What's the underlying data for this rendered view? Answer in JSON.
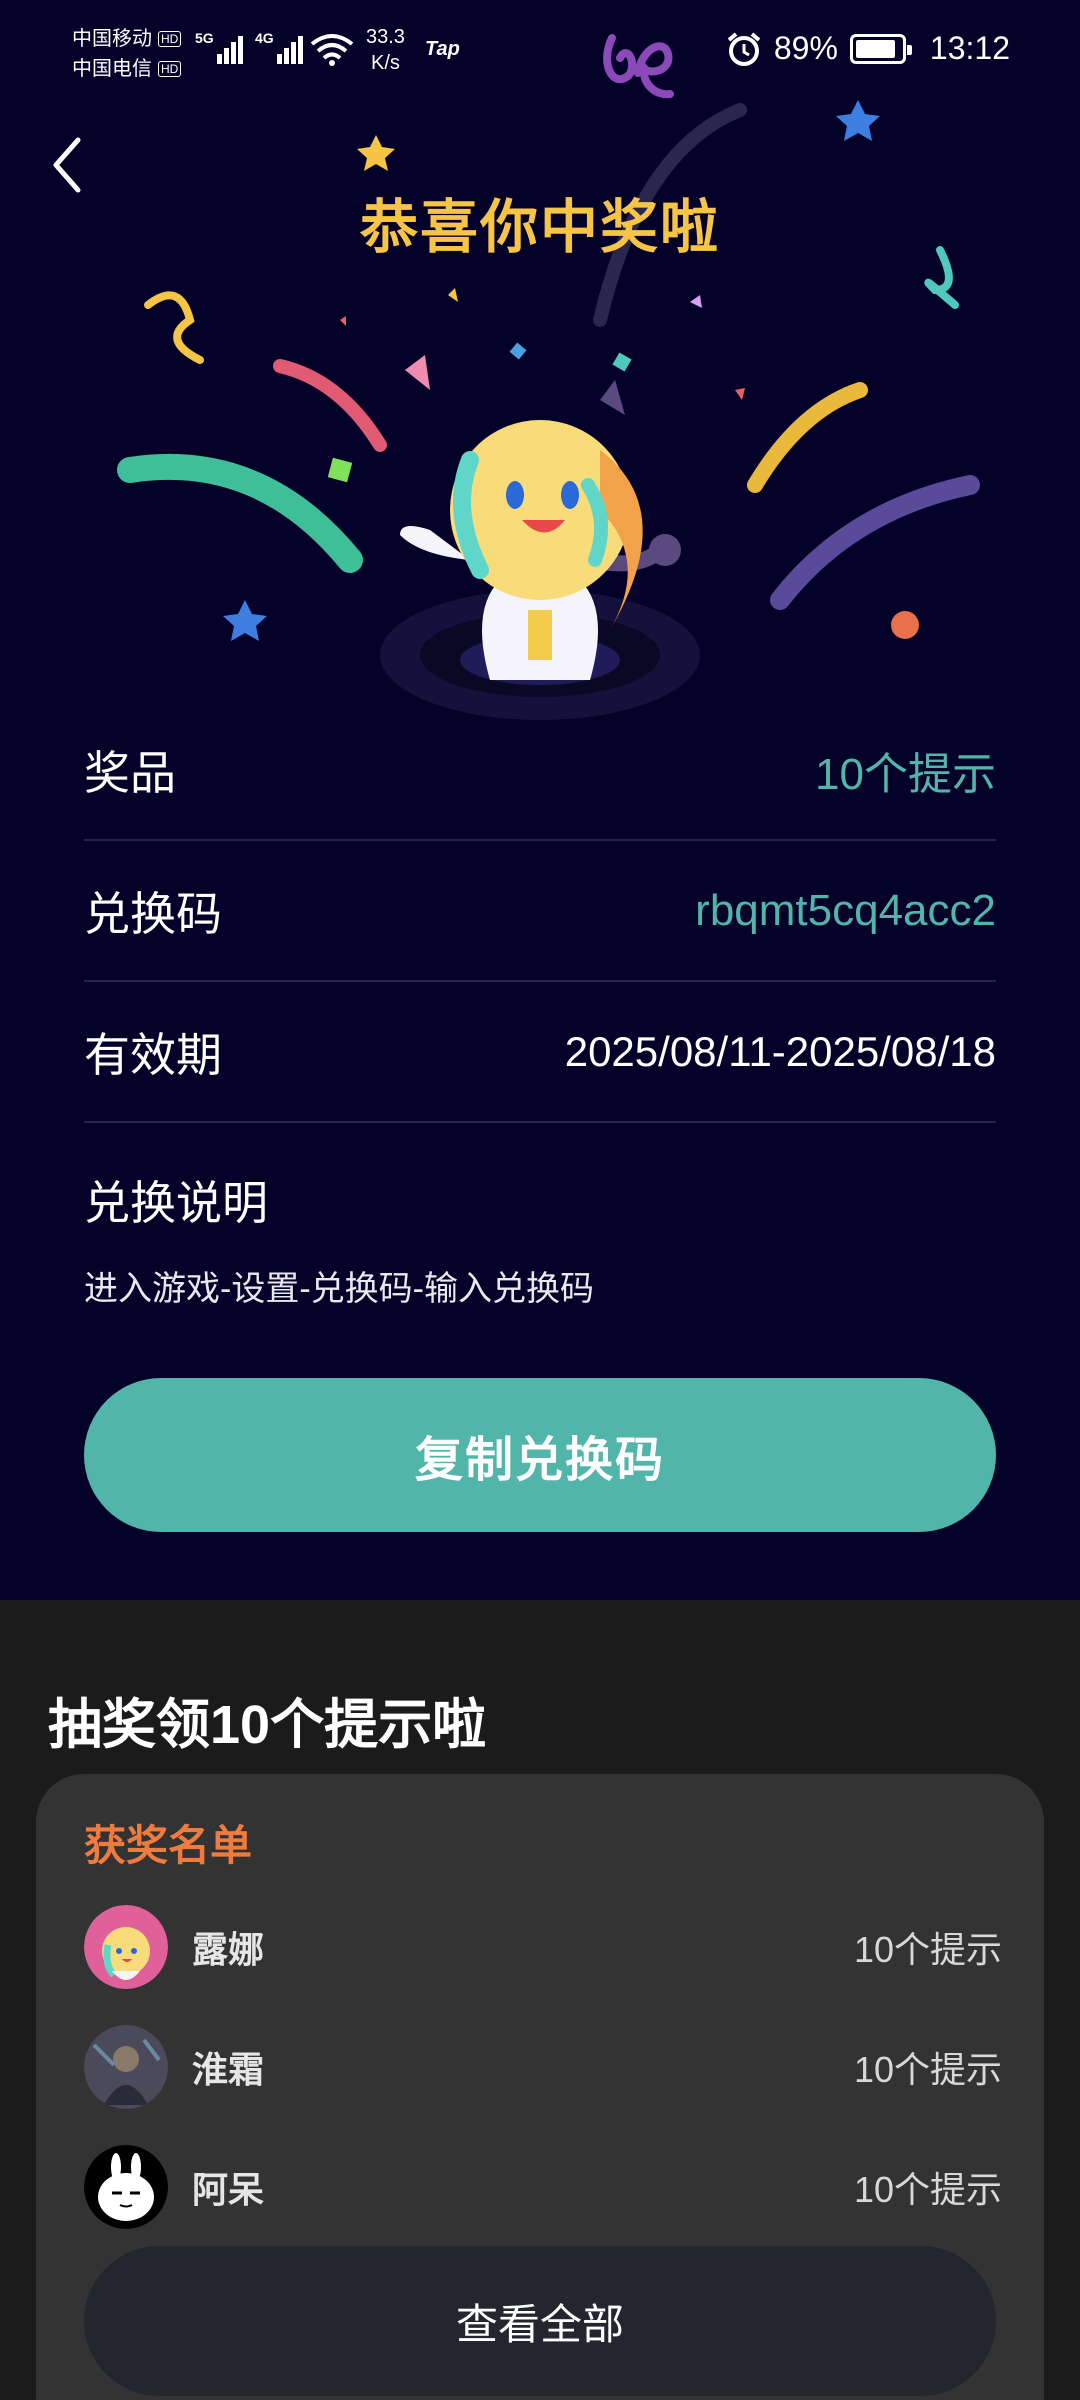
{
  "status_bar": {
    "carrier1": "中国移动",
    "carrier2": "中国电信",
    "hd": "HD",
    "sig1_tech": "5G",
    "sig2_tech": "4G",
    "speed_value": "33.3",
    "speed_unit": "K/s",
    "tap_icon": "Tap",
    "battery_percent": "89%",
    "battery_level": 0.89,
    "time": "13:12"
  },
  "header": {
    "back_icon": "chevron-left-icon",
    "title": "恭喜你中奖啦"
  },
  "prize": {
    "prize_label": "奖品",
    "prize_value": "10个提示",
    "code_label": "兑换码",
    "code_value": "rbqmt5cq4acc2",
    "validity_label": "有效期",
    "validity_value": "2025/08/11-2025/08/18",
    "instructions_label": "兑换说明",
    "instructions_text": "进入游戏-设置-兑换码-输入兑换码",
    "copy_button": "复制兑换码"
  },
  "lottery": {
    "section_title": "抽奖领10个提示啦",
    "winners_title": "获奖名单",
    "winners": [
      {
        "name": "露娜",
        "prize": "10个提示"
      },
      {
        "name": "淮霜",
        "prize": "10个提示"
      },
      {
        "name": "阿呆",
        "prize": "10个提示"
      }
    ],
    "view_all": "查看全部"
  },
  "colors": {
    "background_top": "#05022a",
    "accent_teal": "#52b5a9",
    "title_gold": "#f7c545",
    "winners_orange": "#ef7b3f",
    "card_bg": "#333333"
  }
}
